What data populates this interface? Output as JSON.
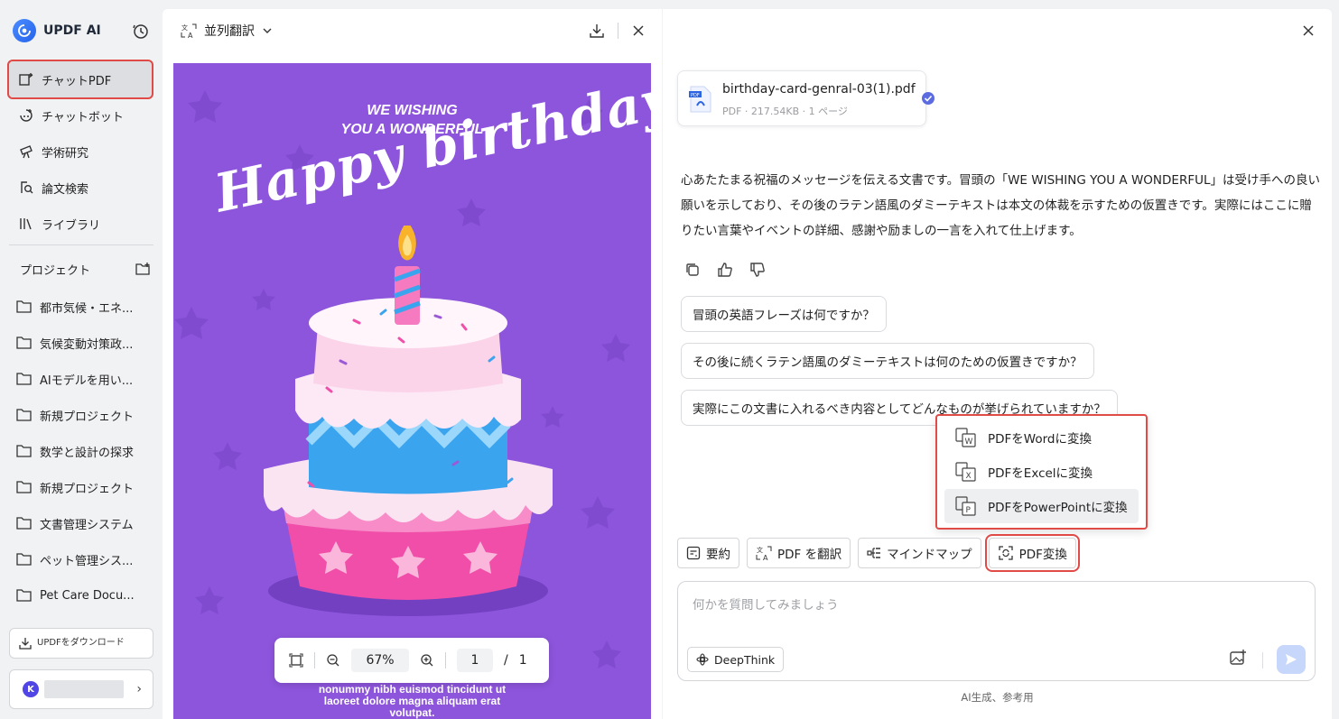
{
  "app": {
    "name": "UPDF AI"
  },
  "sidebar": {
    "nav": [
      {
        "label": "チャットPDF",
        "icon": "chat-pdf-icon",
        "active": true
      },
      {
        "label": "チャットボット",
        "icon": "chatbot-icon"
      },
      {
        "label": "学術研究",
        "icon": "research-icon"
      },
      {
        "label": "論文検索",
        "icon": "paper-search-icon"
      },
      {
        "label": "ライブラリ",
        "icon": "library-icon"
      }
    ],
    "projects_title": "プロジェクト",
    "projects": [
      "都市気候・エネ...",
      "気候変動対策政...",
      "AIモデルを用い...",
      "新規プロジェクト",
      "数学と設計の探求",
      "新規プロジェクト",
      "文書管理システム",
      "ペット管理シス...",
      "Pet Care Docu..."
    ],
    "download_label": "UPDFをダウンロード",
    "avatar_initial": "K"
  },
  "pdf_viewer": {
    "mode_label": "並列翻訳",
    "page_text": {
      "wish_line1": "WE WISHING",
      "wish_line2": "YOU A WONDERFUL",
      "script": "Happy birthday",
      "lorem_line1": "nonummy nibh euismod tincidunt ut",
      "lorem_line2": "laoreet dolore magna aliquam erat",
      "lorem_line3": "volutpat."
    },
    "zoom": "67%",
    "current_page": "1",
    "page_sep": "/",
    "total_pages": "1"
  },
  "chat": {
    "file": {
      "name": "birthday-card-genral-03(1).pdf",
      "meta": "PDF · 217.54KB · 1 ページ"
    },
    "answer": "心あたたまる祝福のメッセージを伝える文書です。冒頭の「WE WISHING YOU A WONDERFUL」は受け手への良い願いを示しており、その後のラテン語風のダミーテキストは本文の体裁を示すための仮置きです。実際にはここに贈りたい言葉やイベントの詳細、感謝や励ましの一言を入れて仕上げます。",
    "suggestions": [
      "冒頭の英語フレーズは何ですか？",
      "その後に続くラテン語風のダミーテキストは何のための仮置きですか？",
      "実際にこの文書に入れるべき内容としてどんなものが挙げられていますか？"
    ],
    "convert_menu": [
      {
        "label": "PDFをWordに変換",
        "letter": "W"
      },
      {
        "label": "PDFをExcelに変換",
        "letter": "X"
      },
      {
        "label": "PDFをPowerPointに変換",
        "letter": "P"
      }
    ],
    "tools": {
      "summary": "要約",
      "translate": "PDF を翻訳",
      "mindmap": "マインドマップ",
      "convert": "PDF変換"
    },
    "input_placeholder": "何かを質問してみましょう",
    "deepthink_label": "DeepThink",
    "footnote": "AI生成、参考用"
  },
  "colors": {
    "accent": "#2563eb",
    "highlight": "#e04a47",
    "card_bg": "#8d55dc"
  }
}
